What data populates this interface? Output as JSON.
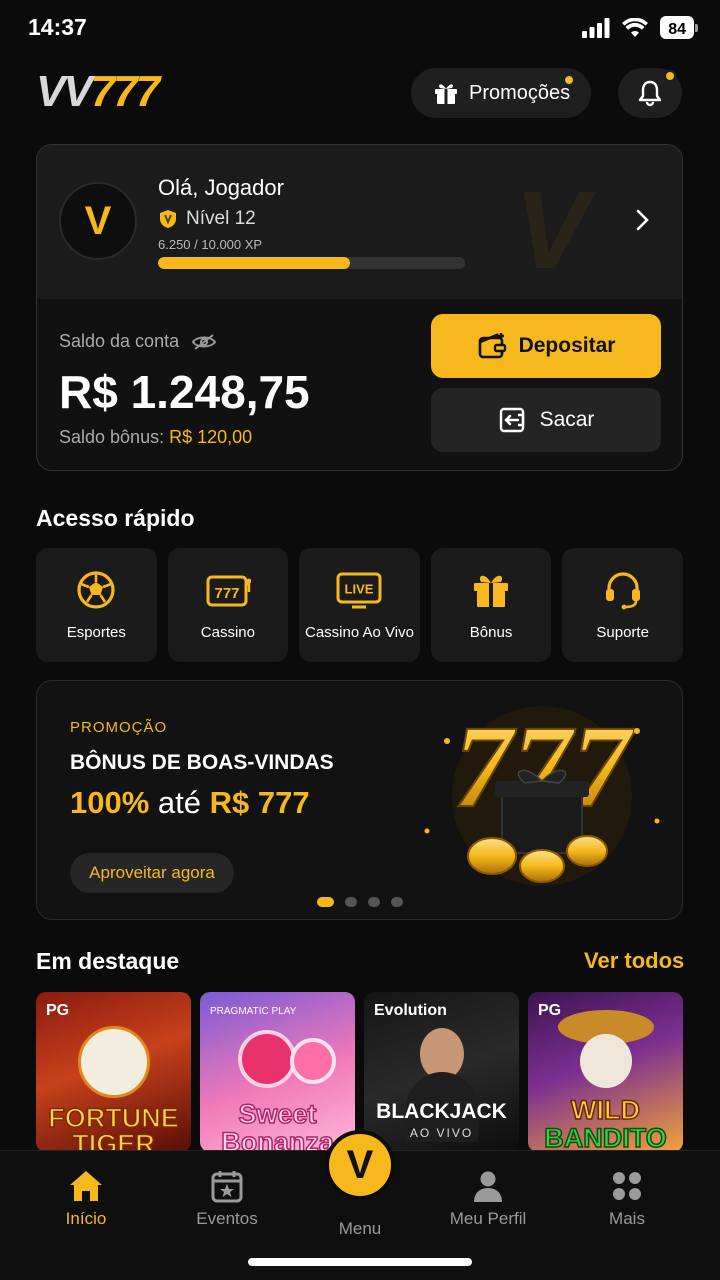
{
  "status_bar": {
    "time": "14:37",
    "battery": "84"
  },
  "header": {
    "logo_vv": "VV",
    "logo_777": "777",
    "promo_label": "Promoções"
  },
  "account": {
    "avatar_letter": "V",
    "greeting": "Olá, Jogador",
    "level": "Nível 12",
    "xp": "6.250 / 10.000 XP",
    "xp_progress": 0.625,
    "balance_label": "Saldo da conta",
    "balance": "R$ 1.248,75",
    "bonus_label": "Saldo bônus:",
    "bonus_value": "R$ 120,00",
    "deposit_label": "Depositar",
    "withdraw_label": "Sacar"
  },
  "quick_access": {
    "title": "Acesso rápido",
    "items": [
      {
        "label": "Esportes",
        "icon": "soccer-ball-icon"
      },
      {
        "label": "Cassino",
        "icon": "slot-777-icon"
      },
      {
        "label": "Cassino Ao Vivo",
        "icon": "live-icon"
      },
      {
        "label": "Bônus",
        "icon": "gift-icon"
      },
      {
        "label": "Suporte",
        "icon": "headset-icon"
      }
    ]
  },
  "banner": {
    "tag": "PROMOÇÃO",
    "title": "BÔNUS DE BOAS-VINDAS",
    "big_pct": "100%",
    "big_mid": "até",
    "big_amount": "R$ 777",
    "art_text": "777",
    "cta": "Aproveitar agora",
    "active_slide": 1,
    "slides": 4
  },
  "featured": {
    "title": "Em destaque",
    "see_all": "Ver todos",
    "games": [
      {
        "provider": "PG",
        "name_line1": "FORTUNE",
        "name_line2": "TIGER"
      },
      {
        "provider": "PRAGMATIC PLAY",
        "name_line1": "Sweet",
        "name_line2": "Bonanza"
      },
      {
        "provider": "Evolution",
        "name_line1": "BLACKJACK",
        "sub": "AO VIVO"
      },
      {
        "provider": "PG",
        "name_line1": "WILD",
        "name_line2": "BANDITO"
      }
    ]
  },
  "tabbar": {
    "items": [
      {
        "label": "Início",
        "icon": "home-icon",
        "active": true
      },
      {
        "label": "Eventos",
        "icon": "calendar-star-icon",
        "active": false
      },
      {
        "label": "Menu",
        "icon": "v-logo-icon",
        "active": false
      },
      {
        "label": "Meu Perfil",
        "icon": "person-icon",
        "active": false
      },
      {
        "label": "Mais",
        "icon": "grid-icon",
        "active": false
      }
    ]
  },
  "colors": {
    "accent": "#f6b81c",
    "background": "#0b0b0b",
    "card": "#1b1b1b"
  }
}
